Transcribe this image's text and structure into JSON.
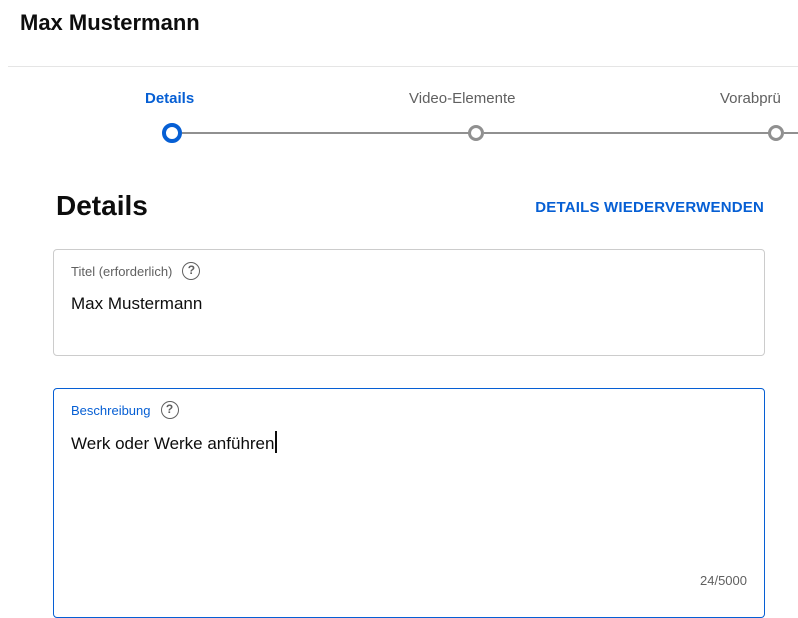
{
  "header": {
    "title": "Max Mustermann"
  },
  "stepper": {
    "steps": [
      {
        "label": "Details",
        "state": "active"
      },
      {
        "label": "Video-Elemente",
        "state": "inactive"
      },
      {
        "label": "Vorabprü",
        "state": "inactive"
      }
    ]
  },
  "section": {
    "title": "Details",
    "reuse_label": "DETAILS WIEDERVERWENDEN"
  },
  "fields": {
    "title": {
      "label": "Titel (erforderlich)",
      "help": "?",
      "value": "Max Mustermann"
    },
    "description": {
      "label": "Beschreibung",
      "help": "?",
      "value": "Werk oder Werke anführen",
      "counter": "24/5000"
    }
  },
  "colors": {
    "accent": "#065fd4",
    "inactive": "#909090",
    "border": "#cccccc"
  }
}
